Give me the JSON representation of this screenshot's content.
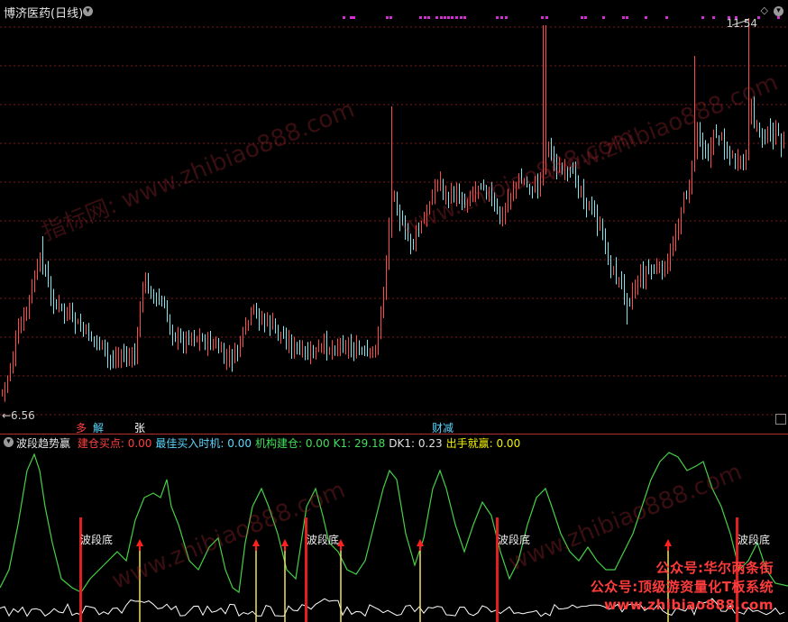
{
  "header": {
    "title": "博济医药(日线)",
    "high_label": "11.54",
    "low_label": "←6.56"
  },
  "signals": {
    "s1": "多",
    "s2": "解",
    "s3": "张",
    "s4": "财减"
  },
  "indicator": {
    "name": "波段趋势赢",
    "items": [
      {
        "label": "建仓买点: 0.00",
        "color": "#ff4040"
      },
      {
        "label": "最佳买入时机: 0.00",
        "color": "#5ad8ff"
      },
      {
        "label": "机构建仓: 0.00",
        "color": "#3ee05a"
      },
      {
        "label": "K1: 29.18",
        "color": "#3ee05a"
      },
      {
        "label": "DK1: 0.23",
        "color": "#e0e0e0"
      },
      {
        "label": "出手就赢: 0.00",
        "color": "#f0f000"
      }
    ],
    "bottom_label": "波段底"
  },
  "watermarks": {
    "w1": "指标网: www.zhibiao888.com",
    "w2": "www.zhibiao888.com"
  },
  "promo": {
    "line1": "公众号:华尔两条街",
    "line2": "公众号:顶级游资量化T板系统",
    "line3": "www.zhibiao888.com"
  },
  "colors": {
    "up": "#ff4a4a",
    "down": "#7fe6f0",
    "grid": "#7a1a1a",
    "k_line": "#46d046",
    "dk_line": "#ffffff",
    "bottom_bar": "#e02020",
    "arrow": "#ff2020"
  }
}
